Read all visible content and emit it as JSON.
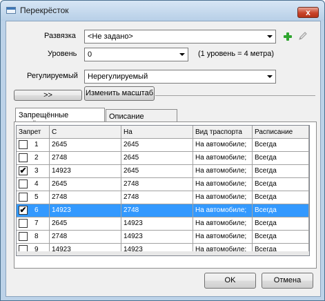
{
  "window": {
    "title": "Перекрёсток",
    "close_glyph": "x"
  },
  "form": {
    "binding_label": "Развязка",
    "binding_value": "<Не задано>",
    "level_label": "Уровень",
    "level_value": "0",
    "level_hint": "(1 уровень = 4 метра)",
    "regulated_label": "Регулируемый",
    "regulated_value": "Нерегулируемый",
    "expand_label": ">>",
    "scale_button": "Изменить масштаб"
  },
  "tabs": [
    {
      "label": "Запрещённые манёвры",
      "active": true
    },
    {
      "label": "Описание проезда",
      "active": false
    }
  ],
  "table": {
    "columns": [
      "Запрет",
      "С",
      "На",
      "Вид траспорта",
      "Расписание"
    ],
    "rows": [
      {
        "num": "1",
        "checked": false,
        "from": "2645",
        "to": "2645",
        "transport": "На автомобиле;",
        "schedule": "Всегда",
        "selected": false
      },
      {
        "num": "2",
        "checked": false,
        "from": "2748",
        "to": "2645",
        "transport": "На автомобиле;",
        "schedule": "Всегда",
        "selected": false
      },
      {
        "num": "3",
        "checked": true,
        "from": "14923",
        "to": "2645",
        "transport": "На автомобиле;",
        "schedule": "Всегда",
        "selected": false
      },
      {
        "num": "4",
        "checked": false,
        "from": "2645",
        "to": "2748",
        "transport": "На автомобиле;",
        "schedule": "Всегда",
        "selected": false
      },
      {
        "num": "5",
        "checked": false,
        "from": "2748",
        "to": "2748",
        "transport": "На автомобиле;",
        "schedule": "Всегда",
        "selected": false
      },
      {
        "num": "6",
        "checked": true,
        "from": "14923",
        "to": "2748",
        "transport": "На автомобиле;",
        "schedule": "Всегда",
        "selected": true
      },
      {
        "num": "7",
        "checked": false,
        "from": "2645",
        "to": "14923",
        "transport": "На автомобиле;",
        "schedule": "Всегда",
        "selected": false
      },
      {
        "num": "8",
        "checked": false,
        "from": "2748",
        "to": "14923",
        "transport": "На автомобиле;",
        "schedule": "Всегда",
        "selected": false
      },
      {
        "num": "9",
        "checked": false,
        "from": "14923",
        "to": "14923",
        "transport": "На автомобиле;",
        "schedule": "Всегда",
        "selected": false
      }
    ]
  },
  "buttons": {
    "ok": "OK",
    "cancel": "Отмена"
  },
  "icons": {
    "add": "plus-icon",
    "edit": "pencil-icon",
    "check_glyph": "✔"
  }
}
